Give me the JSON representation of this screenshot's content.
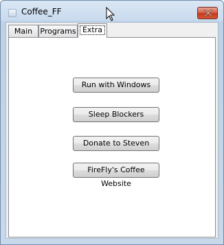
{
  "window": {
    "title": "Coffee_FF"
  },
  "tabs": [
    {
      "label": "Main"
    },
    {
      "label": "Programs"
    },
    {
      "label": "Extra"
    }
  ],
  "active_tab": "Extra",
  "buttons": {
    "run_with_windows": "Run with Windows",
    "sleep_blockers": "Sleep Blockers",
    "donate": "Donate to Steven",
    "website": "FireFly's Coffee Website"
  },
  "icons": {
    "app": "app-icon",
    "close": "close-icon",
    "cursor": "mouse-cursor-icon"
  }
}
